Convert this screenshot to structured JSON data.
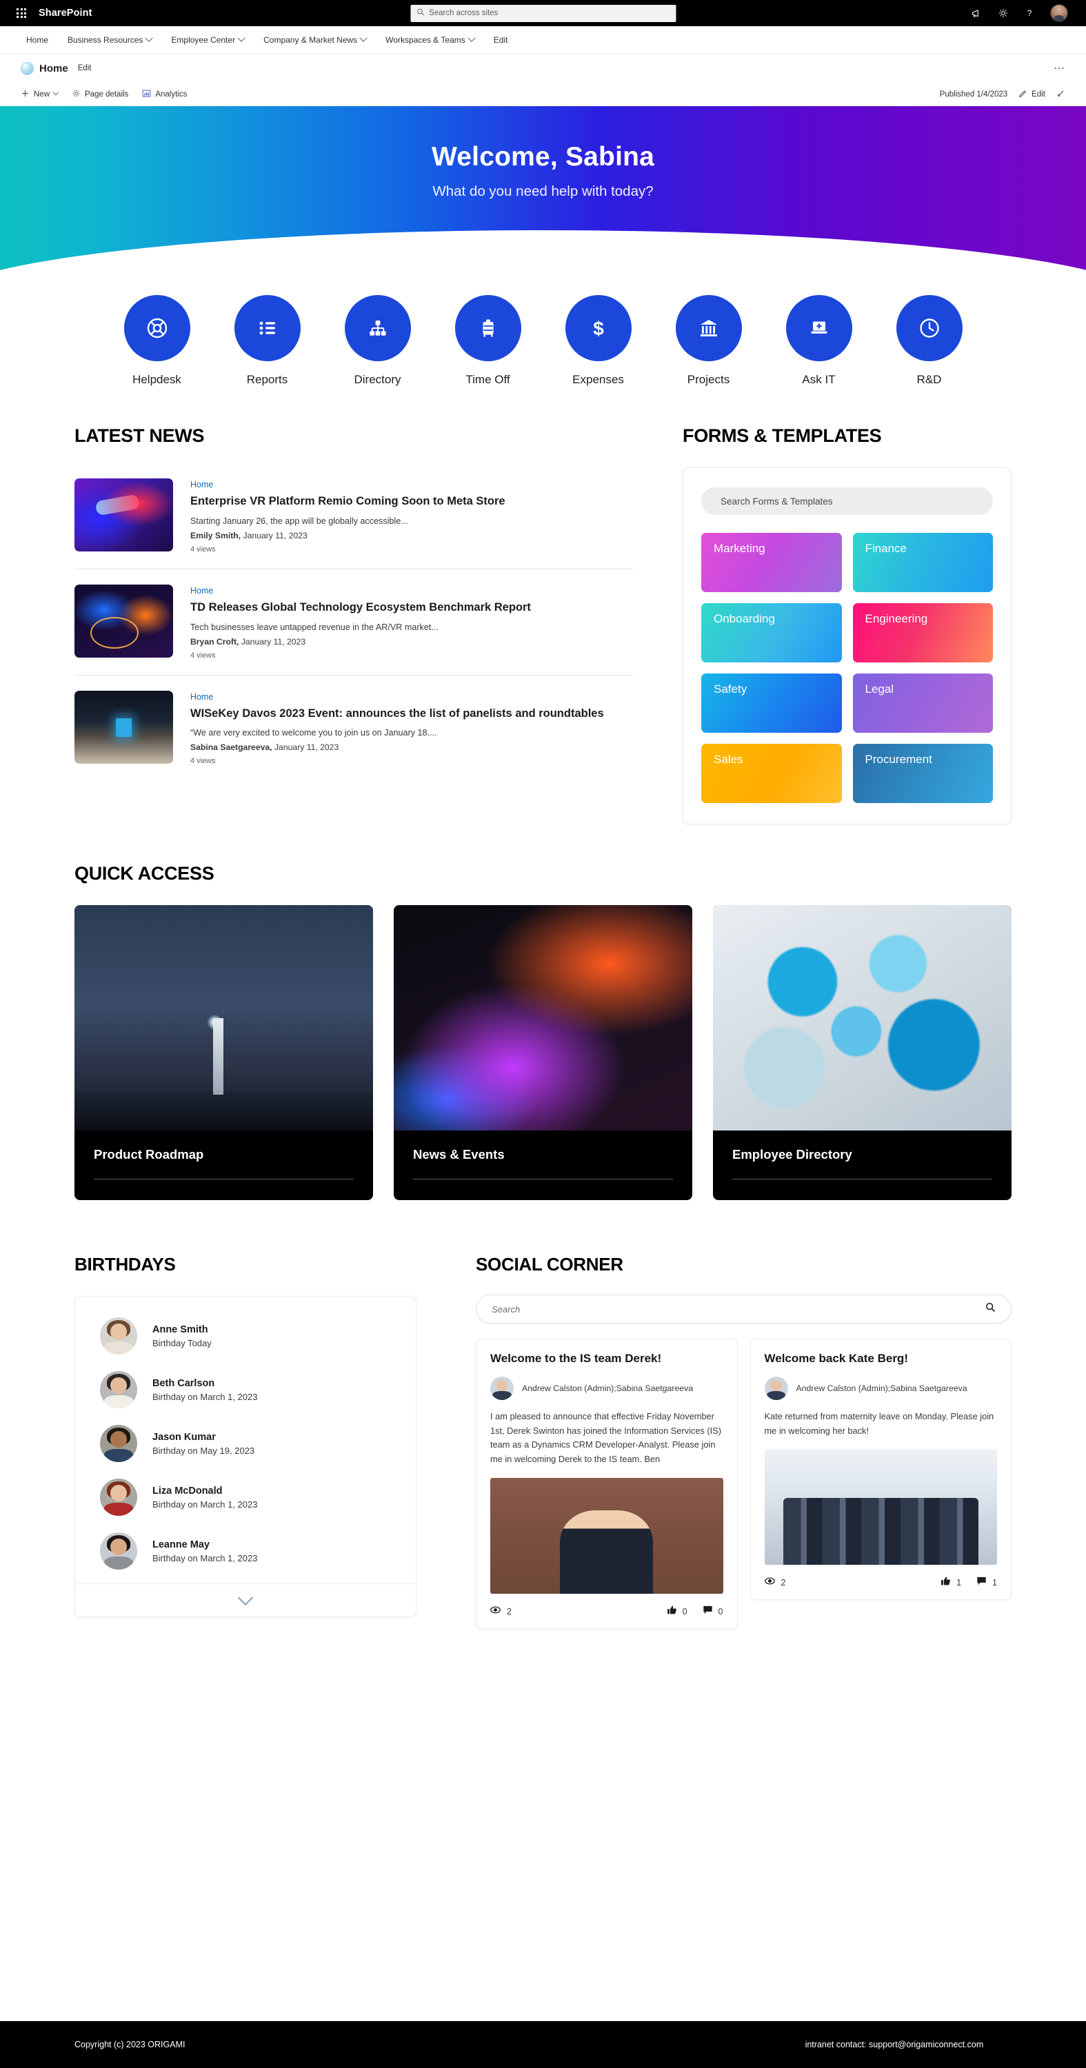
{
  "suitebar": {
    "waffle_icon": "waffle-icon",
    "title": "SharePoint",
    "search_placeholder": "Search across sites",
    "search_icon": "search-icon",
    "megaphone_icon": "megaphone-icon",
    "settings_icon": "gear-icon",
    "help_icon": "question-mark-icon",
    "avatar": "user-avatar"
  },
  "sitenav": {
    "items": [
      {
        "label": "Home",
        "has_chevron": false
      },
      {
        "label": "Business Resources",
        "has_chevron": true
      },
      {
        "label": "Employee Center",
        "has_chevron": true
      },
      {
        "label": "Company & Market News",
        "has_chevron": true
      },
      {
        "label": "Workspaces & Teams",
        "has_chevron": true
      },
      {
        "label": "Edit",
        "has_chevron": false
      }
    ]
  },
  "siteheader": {
    "logo_icon": "site-logo-icon",
    "site_name": "Home",
    "edit_label": "Edit",
    "overflow_icon": "more-options-icon"
  },
  "commandbar": {
    "new_label": "New",
    "new_icon": "plus-icon",
    "page_details_label": "Page details",
    "page_details_icon": "gear-icon",
    "analytics_label": "Analytics",
    "analytics_icon": "bar-chart-icon",
    "published_label": "Published 1/4/2023",
    "edit_label": "Edit",
    "edit_icon": "pencil-icon",
    "expand_icon": "expand-icon"
  },
  "hero": {
    "title": "Welcome, Sabina",
    "subtitle": "What do you need help with today?",
    "gradient_from": "#0dc0c0",
    "gradient_mid": "#1364e4",
    "gradient_to": "#7a06c4"
  },
  "quicklinks": {
    "accent_color": "#1b47da",
    "items": [
      {
        "label": "Helpdesk",
        "icon": "lifebuoy-icon"
      },
      {
        "label": "Reports",
        "icon": "list-icon"
      },
      {
        "label": "Directory",
        "icon": "org-chart-icon"
      },
      {
        "label": "Time Off",
        "icon": "suitcase-icon"
      },
      {
        "label": "Expenses",
        "icon": "dollar-sign-icon"
      },
      {
        "label": "Projects",
        "icon": "bank-icon"
      },
      {
        "label": "Ask IT",
        "icon": "laptop-plus-icon"
      },
      {
        "label": "R&D",
        "icon": "clock-icon"
      }
    ]
  },
  "news": {
    "heading": "LATEST NEWS",
    "items": [
      {
        "site": "Home",
        "title": "Enterprise VR Platform Remio Coming Soon to Meta Store",
        "description": "Starting January 26, the app will be globally accessible...",
        "author": "Emily Smith,",
        "date": " January 11, 2023",
        "views": "4 views",
        "thumb_class": "thumb-vr"
      },
      {
        "site": "Home",
        "title": "TD Releases Global Technology Ecosystem Benchmark Report",
        "description": "Tech businesses leave untapped revenue in the AR/VR market...",
        "author": "Bryan Croft,",
        "date": " January 11, 2023",
        "views": "4 views",
        "thumb_class": "thumb-hands"
      },
      {
        "site": "Home",
        "title": "WISeKey Davos 2023 Event: announces the list of panelists and roundtables",
        "description": "“We are very excited to welcome you to join us on January 18....",
        "author": "Sabina Saetgareeva,",
        "date": " January 11, 2023",
        "views": "4 views",
        "thumb_class": "thumb-hall"
      }
    ]
  },
  "forms": {
    "heading": "FORMS & TEMPLATES",
    "search_placeholder": "Search Forms & Templates",
    "tiles": [
      {
        "label": "Marketing",
        "class": "t-marketing"
      },
      {
        "label": "Finance",
        "class": "t-finance"
      },
      {
        "label": "Onboarding",
        "class": "t-onboarding"
      },
      {
        "label": "Engineering",
        "class": "t-engineering"
      },
      {
        "label": "Safety",
        "class": "t-safety"
      },
      {
        "label": "Legal",
        "class": "t-legal"
      },
      {
        "label": "Sales",
        "class": "t-sales"
      },
      {
        "label": "Procurement",
        "class": "t-procurement"
      }
    ]
  },
  "quickaccess": {
    "heading": "QUICK ACCESS",
    "cards": [
      {
        "title": "Product Roadmap",
        "img_class": "img-lighthouse"
      },
      {
        "title": "News & Events",
        "img_class": "img-laptop"
      },
      {
        "title": "Employee Directory",
        "img_class": "img-spheres"
      }
    ]
  },
  "birthdays": {
    "heading": "BIRTHDAYS",
    "more_icon": "chevron-down-icon",
    "items": [
      {
        "name": "Anne Smith",
        "sub": "Birthday Today",
        "skin": "#e8c4a4",
        "hair": "#6b4a33",
        "top": "#e8e2d8",
        "bg": "#d8d5d0"
      },
      {
        "name": "Beth Carlson",
        "sub": "Birthday on March 1, 2023",
        "skin": "#e3bb9b",
        "hair": "#2b2420",
        "top": "#f2efe9",
        "bg": "#b9b9b9"
      },
      {
        "name": "Jason Kumar",
        "sub": "Birthday on May 19, 2023",
        "skin": "#a9764f",
        "hair": "#1d1713",
        "top": "#2f4460",
        "bg": "#9d9d94"
      },
      {
        "name": "Liza McDonald",
        "sub": "Birthday on March 1, 2023",
        "skin": "#e8c0a2",
        "hair": "#7a2d18",
        "top": "#b02a2a",
        "bg": "#a8a8a2"
      },
      {
        "name": "Leanne May",
        "sub": "Birthday on March 1, 2023",
        "skin": "#d9ab85",
        "hair": "#1b1512",
        "top": "#8d9195",
        "bg": "#c7ccd2"
      }
    ]
  },
  "social": {
    "heading": "SOCIAL CORNER",
    "search_placeholder": "Search",
    "search_icon": "search-icon",
    "posts": [
      {
        "title": "Welcome to the IS team Derek!",
        "author": "Andrew Calston (Admin);Sabina Saetgareeva",
        "text": "I am pleased to announce that effective Friday November 1st, Derek Swinton has joined the Information Services (IS) team as a Dynamics CRM Developer-Analyst. Please join me in welcoming Derek to the IS team. Ben",
        "img_class": "img-derek",
        "views_icon": "eye-icon",
        "views": "2",
        "likes_icon": "thumbs-up-icon",
        "likes": "0",
        "comments_icon": "comment-icon",
        "comments": "0"
      },
      {
        "title": "Welcome back Kate Berg!",
        "author": "Andrew Calston (Admin);Sabina Saetgareeva",
        "text": "Kate returned from maternity leave on Monday. Please join me in welcoming her back!",
        "img_class": "img-team",
        "views_icon": "eye-icon",
        "views": "2",
        "likes_icon": "thumbs-up-icon",
        "likes": "1",
        "comments_icon": "comment-icon",
        "comments": "1"
      }
    ]
  },
  "footer": {
    "copyright": "Copyright (c) 2023 ORIGAMI",
    "contact": "intranet contact: support@origamiconnect.com"
  }
}
